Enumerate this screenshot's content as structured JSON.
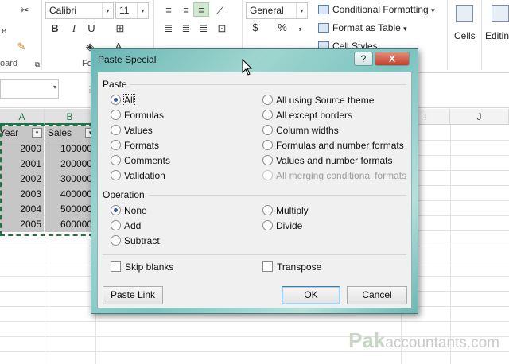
{
  "ribbon": {
    "font_name": "Calibri",
    "font_size": "11",
    "number_format": "General",
    "conditional_formatting": "Conditional Formatting",
    "format_as_table": "Format as Table",
    "cell_styles": "Cell Styles",
    "cells_label": "Cells",
    "editing_label": "Editing",
    "clipboard_label": "oard",
    "font_group_label": "Fo",
    "bold": "B",
    "italic": "I",
    "underline": "U",
    "currency": "$",
    "percent": "%",
    "comma": ",",
    "cut_glyph": "✂",
    "dropdown_glyph": "▾",
    "launcher_glyph": "⧉",
    "name_box_arrow": "▾",
    "dialog_launcher_label": "F"
  },
  "sheet": {
    "columns": [
      "A",
      "B",
      "I",
      "J"
    ],
    "header_a": "Year",
    "header_b": "Sales",
    "rows": [
      {
        "year": "2000",
        "sales": "100000"
      },
      {
        "year": "2001",
        "sales": "200000"
      },
      {
        "year": "2002",
        "sales": "300000"
      },
      {
        "year": "2003",
        "sales": "400000"
      },
      {
        "year": "2004",
        "sales": "500000"
      },
      {
        "year": "2005",
        "sales": "600000"
      }
    ]
  },
  "watermark": {
    "brand": "Pak",
    "rest": "accountants.com"
  },
  "dialog": {
    "title": "Paste Special",
    "help": "?",
    "close": "X",
    "paste_section": "Paste",
    "paste_options_left": [
      "All",
      "Formulas",
      "Values",
      "Formats",
      "Comments",
      "Validation"
    ],
    "paste_options_right": [
      "All using Source theme",
      "All except borders",
      "Column widths",
      "Formulas and number formats",
      "Values and number formats",
      "All merging conditional formats"
    ],
    "paste_selected": "All",
    "operation_section": "Operation",
    "operation_left": [
      "None",
      "Add",
      "Subtract"
    ],
    "operation_right": [
      "Multiply",
      "Divide"
    ],
    "operation_selected": "None",
    "skip_blanks": "Skip blanks",
    "transpose": "Transpose",
    "paste_link": "Paste Link",
    "ok": "OK",
    "cancel": "Cancel"
  },
  "colors": {
    "accent_green": "#217346",
    "dialog_frame": "#7cc4c1",
    "close_red": "#c2412c"
  }
}
